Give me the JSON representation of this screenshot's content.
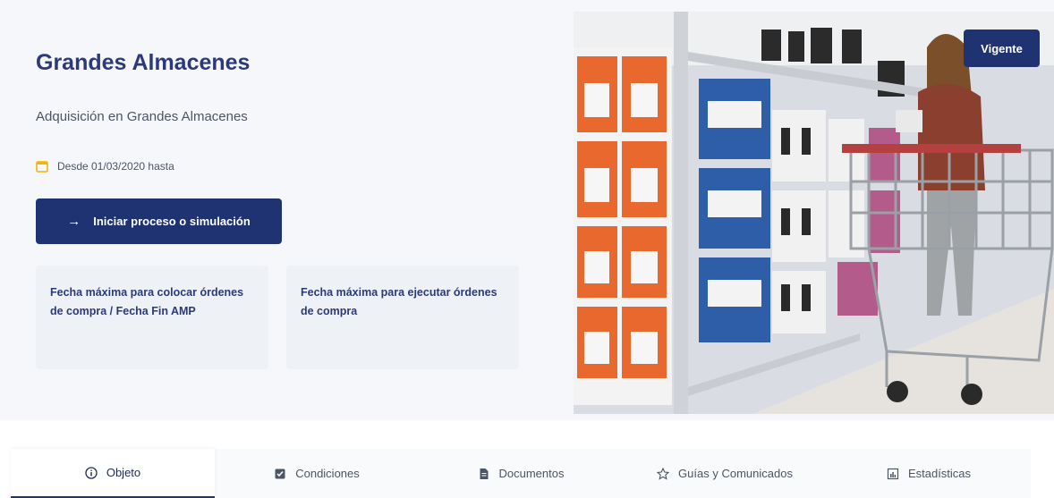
{
  "hero": {
    "title": "Grandes Almacenes",
    "subtitle": "Adquisición en Grandes Almacenes",
    "dates": "Desde 01/03/2020 hasta",
    "cta_label": "Iniciar proceso o simulación",
    "card1": "Fecha máxima para colocar órdenes de compra / Fecha Fin AMP",
    "card2": "Fecha máxima para ejecutar órdenes de compra",
    "status_badge": "Vigente"
  },
  "tabs": [
    {
      "label": "Objeto",
      "icon": "info-circle-icon"
    },
    {
      "label": "Condiciones",
      "icon": "checklist-icon"
    },
    {
      "label": "Documentos",
      "icon": "document-icon"
    },
    {
      "label": "Guías y Comunicados",
      "icon": "star-icon"
    },
    {
      "label": "Estadísticas",
      "icon": "chart-icon"
    }
  ],
  "colors": {
    "primary": "#1f3372",
    "title": "#2b3a7a",
    "calendar": "#f5b400",
    "background": "#f5f7fa"
  }
}
